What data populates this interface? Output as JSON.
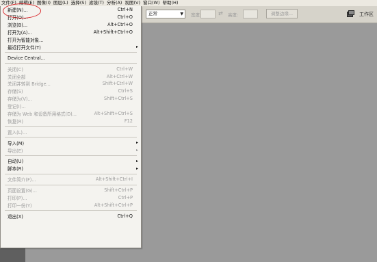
{
  "menubar": {
    "items": [
      "文件(F)",
      "编辑(E)",
      "图像(I)",
      "图层(L)",
      "选择(S)",
      "滤镜(T)",
      "分析(A)",
      "视图(V)",
      "窗口(W)",
      "帮助(H)"
    ]
  },
  "options": {
    "mode_value": "正常",
    "width_label": "宽度:",
    "height_label": "高度:",
    "adjust_button": "调整边缘...",
    "workspace_label": "工作区"
  },
  "file_menu": {
    "items": [
      {
        "label": "新建(N)...",
        "shortcut": "Ctrl+N",
        "disabled": false
      },
      {
        "label": "打开(O)...",
        "shortcut": "Ctrl+O",
        "disabled": false
      },
      {
        "label": "浏览(B)...",
        "shortcut": "Alt+Ctrl+O",
        "disabled": false
      },
      {
        "label": "打开为(A)...",
        "shortcut": "Alt+Shift+Ctrl+O",
        "disabled": false
      },
      {
        "label": "打开为智能对象...",
        "shortcut": "",
        "disabled": false
      },
      {
        "label": "最近打开文件(T)",
        "shortcut": "",
        "disabled": false,
        "submenu": true
      },
      {
        "sep": true
      },
      {
        "label": "Device Central...",
        "shortcut": "",
        "disabled": false
      },
      {
        "sep": true
      },
      {
        "label": "关闭(C)",
        "shortcut": "Ctrl+W",
        "disabled": true
      },
      {
        "label": "关闭全部",
        "shortcut": "Alt+Ctrl+W",
        "disabled": true
      },
      {
        "label": "关闭并转到 Bridge...",
        "shortcut": "Shift+Ctrl+W",
        "disabled": true
      },
      {
        "label": "存储(S)",
        "shortcut": "Ctrl+S",
        "disabled": true
      },
      {
        "label": "存储为(V)...",
        "shortcut": "Shift+Ctrl+S",
        "disabled": true
      },
      {
        "label": "登记(I)...",
        "shortcut": "",
        "disabled": true
      },
      {
        "label": "存储为 Web 和设备所用格式(D)...",
        "shortcut": "Alt+Shift+Ctrl+S",
        "disabled": true
      },
      {
        "label": "恢复(R)",
        "shortcut": "F12",
        "disabled": true
      },
      {
        "sep": true
      },
      {
        "label": "置入(L)...",
        "shortcut": "",
        "disabled": true
      },
      {
        "sep": true
      },
      {
        "label": "导入(M)",
        "shortcut": "",
        "disabled": false,
        "submenu": true
      },
      {
        "label": "导出(E)",
        "shortcut": "",
        "disabled": true,
        "submenu": true
      },
      {
        "sep": true
      },
      {
        "label": "自动(U)",
        "shortcut": "",
        "disabled": false,
        "submenu": true
      },
      {
        "label": "脚本(R)",
        "shortcut": "",
        "disabled": false,
        "submenu": true
      },
      {
        "sep": true
      },
      {
        "label": "文件简介(F)...",
        "shortcut": "Alt+Shift+Ctrl+I",
        "disabled": true
      },
      {
        "sep": true
      },
      {
        "label": "页面设置(G)...",
        "shortcut": "Shift+Ctrl+P",
        "disabled": true
      },
      {
        "label": "打印(P)...",
        "shortcut": "Ctrl+P",
        "disabled": true
      },
      {
        "label": "打印一份(Y)",
        "shortcut": "Alt+Shift+Ctrl+P",
        "disabled": true
      },
      {
        "sep": true
      },
      {
        "label": "退出(X)",
        "shortcut": "Ctrl+Q",
        "disabled": false
      }
    ]
  },
  "colors": {
    "annotation": "#d9262a",
    "canvas": "#9a9a9a",
    "menu_bg": "#f4f3ef"
  }
}
